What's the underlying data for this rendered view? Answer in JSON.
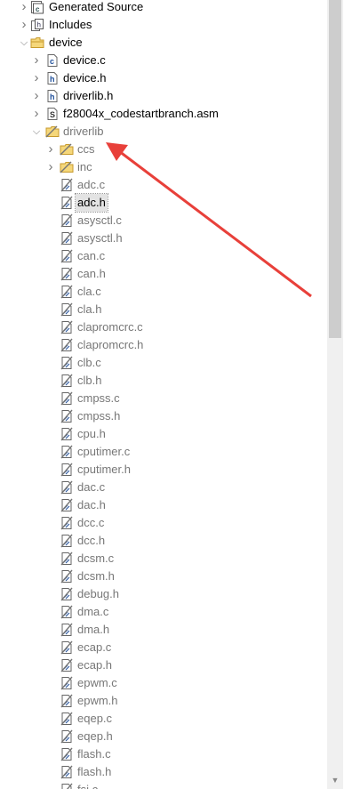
{
  "tree": {
    "items": [
      {
        "label": "Generated Source",
        "level": 1,
        "expand": "collapsed",
        "icon": "source-folder-icon",
        "dim": false
      },
      {
        "label": "Includes",
        "level": 1,
        "expand": "collapsed",
        "icon": "includes-icon",
        "dim": false
      },
      {
        "label": "device",
        "level": 1,
        "expand": "expanded",
        "icon": "folder-icon",
        "dim": false
      },
      {
        "label": "device.c",
        "level": 2,
        "expand": "collapsed",
        "icon": "c-file-icon",
        "dim": false
      },
      {
        "label": "device.h",
        "level": 2,
        "expand": "collapsed",
        "icon": "h-file-icon",
        "dim": false
      },
      {
        "label": "driverlib.h",
        "level": 2,
        "expand": "collapsed",
        "icon": "h-file-icon",
        "dim": false
      },
      {
        "label": "f28004x_codestartbranch.asm",
        "level": 2,
        "expand": "collapsed",
        "icon": "asm-file-icon",
        "dim": false
      },
      {
        "label": "driverlib",
        "level": 2,
        "expand": "expanded",
        "icon": "excluded-folder-icon",
        "dim": true
      },
      {
        "label": "ccs",
        "level": 3,
        "expand": "collapsed",
        "icon": "excluded-folder-icon",
        "dim": true
      },
      {
        "label": "inc",
        "level": 3,
        "expand": "collapsed",
        "icon": "excluded-folder-icon",
        "dim": true
      },
      {
        "label": "adc.c",
        "level": 3,
        "expand": "none",
        "icon": "excluded-file-icon",
        "dim": true
      },
      {
        "label": "adc.h",
        "level": 3,
        "expand": "none",
        "icon": "excluded-file-icon",
        "dim": false,
        "selected": true
      },
      {
        "label": "asysctl.c",
        "level": 3,
        "expand": "none",
        "icon": "excluded-file-icon",
        "dim": true
      },
      {
        "label": "asysctl.h",
        "level": 3,
        "expand": "none",
        "icon": "excluded-file-icon",
        "dim": true
      },
      {
        "label": "can.c",
        "level": 3,
        "expand": "none",
        "icon": "excluded-file-icon",
        "dim": true
      },
      {
        "label": "can.h",
        "level": 3,
        "expand": "none",
        "icon": "excluded-file-icon",
        "dim": true
      },
      {
        "label": "cla.c",
        "level": 3,
        "expand": "none",
        "icon": "excluded-file-icon",
        "dim": true
      },
      {
        "label": "cla.h",
        "level": 3,
        "expand": "none",
        "icon": "excluded-file-icon",
        "dim": true
      },
      {
        "label": "clapromcrc.c",
        "level": 3,
        "expand": "none",
        "icon": "excluded-file-icon",
        "dim": true
      },
      {
        "label": "clapromcrc.h",
        "level": 3,
        "expand": "none",
        "icon": "excluded-file-icon",
        "dim": true
      },
      {
        "label": "clb.c",
        "level": 3,
        "expand": "none",
        "icon": "excluded-file-icon",
        "dim": true
      },
      {
        "label": "clb.h",
        "level": 3,
        "expand": "none",
        "icon": "excluded-file-icon",
        "dim": true
      },
      {
        "label": "cmpss.c",
        "level": 3,
        "expand": "none",
        "icon": "excluded-file-icon",
        "dim": true
      },
      {
        "label": "cmpss.h",
        "level": 3,
        "expand": "none",
        "icon": "excluded-file-icon",
        "dim": true
      },
      {
        "label": "cpu.h",
        "level": 3,
        "expand": "none",
        "icon": "excluded-file-icon",
        "dim": true
      },
      {
        "label": "cputimer.c",
        "level": 3,
        "expand": "none",
        "icon": "excluded-file-icon",
        "dim": true
      },
      {
        "label": "cputimer.h",
        "level": 3,
        "expand": "none",
        "icon": "excluded-file-icon",
        "dim": true
      },
      {
        "label": "dac.c",
        "level": 3,
        "expand": "none",
        "icon": "excluded-file-icon",
        "dim": true
      },
      {
        "label": "dac.h",
        "level": 3,
        "expand": "none",
        "icon": "excluded-file-icon",
        "dim": true
      },
      {
        "label": "dcc.c",
        "level": 3,
        "expand": "none",
        "icon": "excluded-file-icon",
        "dim": true
      },
      {
        "label": "dcc.h",
        "level": 3,
        "expand": "none",
        "icon": "excluded-file-icon",
        "dim": true
      },
      {
        "label": "dcsm.c",
        "level": 3,
        "expand": "none",
        "icon": "excluded-file-icon",
        "dim": true
      },
      {
        "label": "dcsm.h",
        "level": 3,
        "expand": "none",
        "icon": "excluded-file-icon",
        "dim": true
      },
      {
        "label": "debug.h",
        "level": 3,
        "expand": "none",
        "icon": "excluded-file-icon",
        "dim": true
      },
      {
        "label": "dma.c",
        "level": 3,
        "expand": "none",
        "icon": "excluded-file-icon",
        "dim": true
      },
      {
        "label": "dma.h",
        "level": 3,
        "expand": "none",
        "icon": "excluded-file-icon",
        "dim": true
      },
      {
        "label": "ecap.c",
        "level": 3,
        "expand": "none",
        "icon": "excluded-file-icon",
        "dim": true
      },
      {
        "label": "ecap.h",
        "level": 3,
        "expand": "none",
        "icon": "excluded-file-icon",
        "dim": true
      },
      {
        "label": "epwm.c",
        "level": 3,
        "expand": "none",
        "icon": "excluded-file-icon",
        "dim": true
      },
      {
        "label": "epwm.h",
        "level": 3,
        "expand": "none",
        "icon": "excluded-file-icon",
        "dim": true
      },
      {
        "label": "eqep.c",
        "level": 3,
        "expand": "none",
        "icon": "excluded-file-icon",
        "dim": true
      },
      {
        "label": "eqep.h",
        "level": 3,
        "expand": "none",
        "icon": "excluded-file-icon",
        "dim": true
      },
      {
        "label": "flash.c",
        "level": 3,
        "expand": "none",
        "icon": "excluded-file-icon",
        "dim": true
      },
      {
        "label": "flash.h",
        "level": 3,
        "expand": "none",
        "icon": "excluded-file-icon",
        "dim": true
      },
      {
        "label": "fsi.c",
        "level": 3,
        "expand": "none",
        "icon": "excluded-file-icon",
        "dim": true
      }
    ]
  },
  "colors": {
    "annotation_arrow": "#e8403a",
    "dim_text": "#777777",
    "selected_bg": "#e3e3e3"
  }
}
